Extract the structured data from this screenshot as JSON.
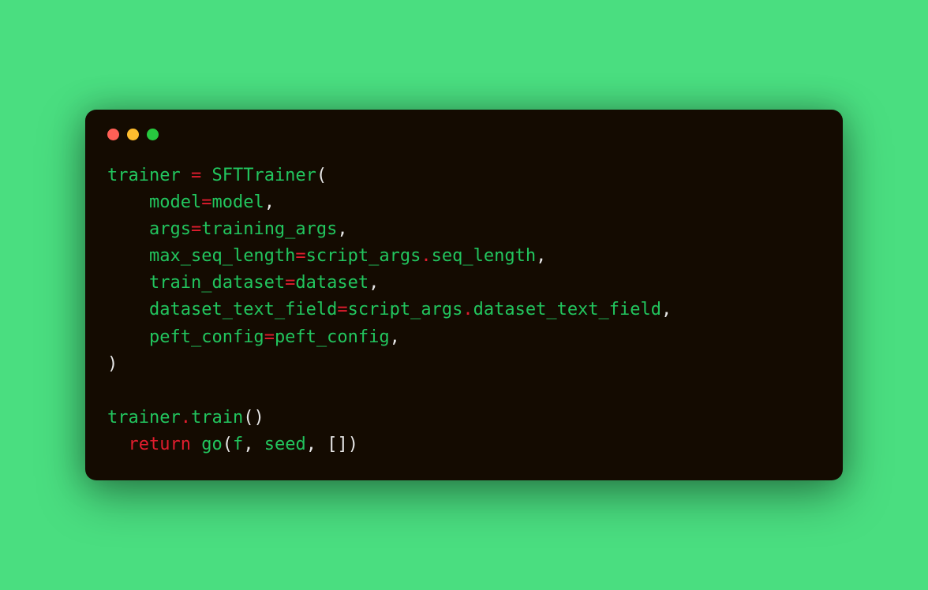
{
  "code": {
    "tokens": [
      {
        "t": "trainer",
        "c": "ident"
      },
      {
        "t": " ",
        "c": "default"
      },
      {
        "t": "=",
        "c": "op"
      },
      {
        "t": " ",
        "c": "default"
      },
      {
        "t": "SFTTrainer",
        "c": "ident"
      },
      {
        "t": "(",
        "c": "default"
      },
      {
        "t": "\n",
        "c": "default"
      },
      {
        "t": "    ",
        "c": "default"
      },
      {
        "t": "model",
        "c": "ident"
      },
      {
        "t": "=",
        "c": "op"
      },
      {
        "t": "model",
        "c": "ident"
      },
      {
        "t": ",",
        "c": "default"
      },
      {
        "t": "\n",
        "c": "default"
      },
      {
        "t": "    ",
        "c": "default"
      },
      {
        "t": "args",
        "c": "ident"
      },
      {
        "t": "=",
        "c": "op"
      },
      {
        "t": "training_args",
        "c": "ident"
      },
      {
        "t": ",",
        "c": "default"
      },
      {
        "t": "\n",
        "c": "default"
      },
      {
        "t": "    ",
        "c": "default"
      },
      {
        "t": "max_seq_length",
        "c": "ident"
      },
      {
        "t": "=",
        "c": "op"
      },
      {
        "t": "script_args",
        "c": "ident"
      },
      {
        "t": ".",
        "c": "op"
      },
      {
        "t": "seq_length",
        "c": "ident"
      },
      {
        "t": ",",
        "c": "default"
      },
      {
        "t": "\n",
        "c": "default"
      },
      {
        "t": "    ",
        "c": "default"
      },
      {
        "t": "train_dataset",
        "c": "ident"
      },
      {
        "t": "=",
        "c": "op"
      },
      {
        "t": "dataset",
        "c": "ident"
      },
      {
        "t": ",",
        "c": "default"
      },
      {
        "t": "\n",
        "c": "default"
      },
      {
        "t": "    ",
        "c": "default"
      },
      {
        "t": "dataset_text_field",
        "c": "ident"
      },
      {
        "t": "=",
        "c": "op"
      },
      {
        "t": "script_args",
        "c": "ident"
      },
      {
        "t": ".",
        "c": "op"
      },
      {
        "t": "dataset_text_field",
        "c": "ident"
      },
      {
        "t": ",",
        "c": "default"
      },
      {
        "t": "\n",
        "c": "default"
      },
      {
        "t": "    ",
        "c": "default"
      },
      {
        "t": "peft_config",
        "c": "ident"
      },
      {
        "t": "=",
        "c": "op"
      },
      {
        "t": "peft_config",
        "c": "ident"
      },
      {
        "t": ",",
        "c": "default"
      },
      {
        "t": "\n",
        "c": "default"
      },
      {
        "t": ")",
        "c": "default"
      },
      {
        "t": "\n",
        "c": "default"
      },
      {
        "t": "\n",
        "c": "default"
      },
      {
        "t": "trainer",
        "c": "ident"
      },
      {
        "t": ".",
        "c": "op"
      },
      {
        "t": "train",
        "c": "ident"
      },
      {
        "t": "()",
        "c": "default"
      },
      {
        "t": "\n",
        "c": "default"
      },
      {
        "t": "  ",
        "c": "default"
      },
      {
        "t": "return",
        "c": "kw"
      },
      {
        "t": " ",
        "c": "default"
      },
      {
        "t": "go",
        "c": "ident"
      },
      {
        "t": "(",
        "c": "default"
      },
      {
        "t": "f",
        "c": "ident"
      },
      {
        "t": ",",
        "c": "default"
      },
      {
        "t": " ",
        "c": "default"
      },
      {
        "t": "seed",
        "c": "ident"
      },
      {
        "t": ",",
        "c": "default"
      },
      {
        "t": " ",
        "c": "default"
      },
      {
        "t": "[]",
        "c": "default"
      },
      {
        "t": ")",
        "c": "default"
      }
    ]
  }
}
